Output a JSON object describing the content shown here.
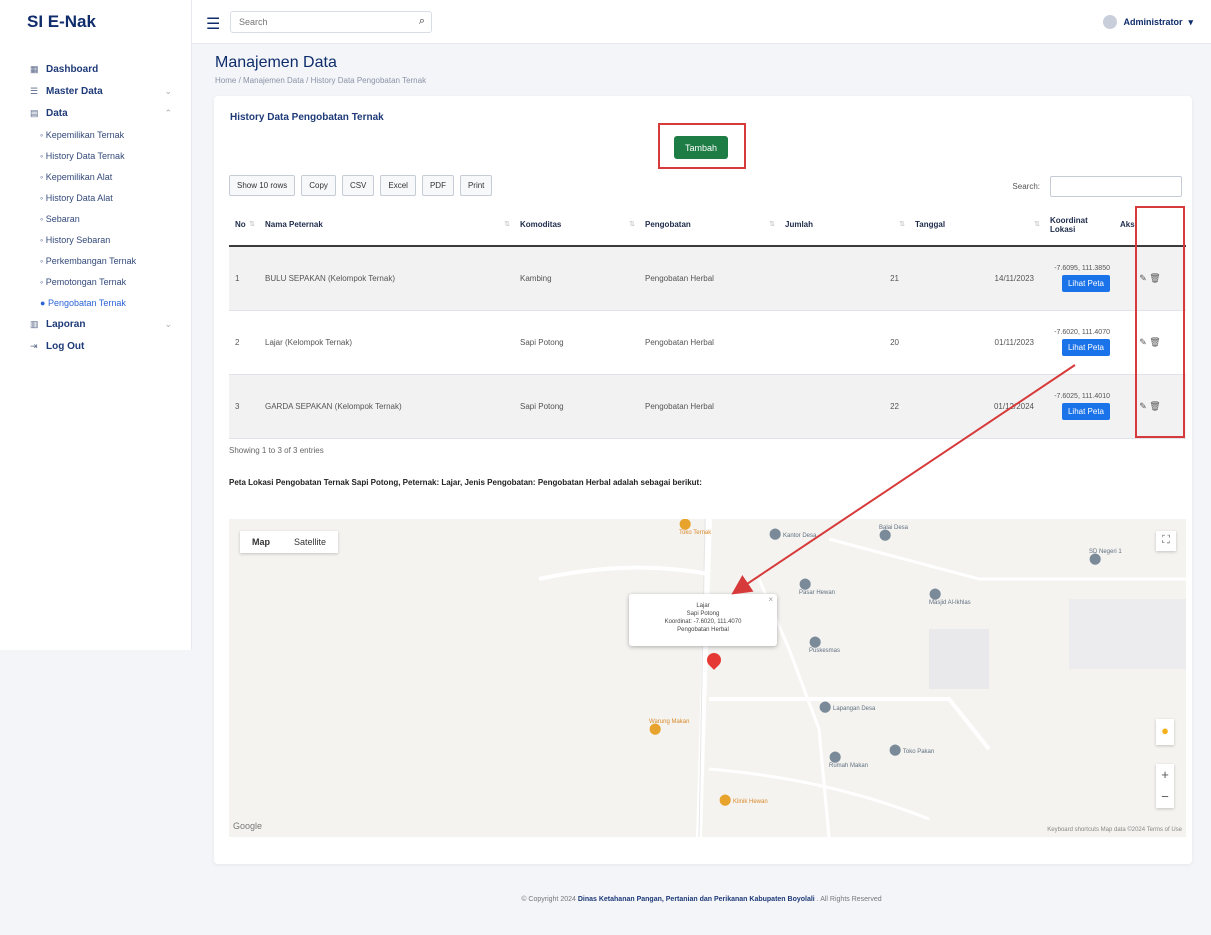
{
  "app": {
    "brand": "SI E-Nak"
  },
  "header": {
    "search_placeholder": "Search",
    "user_name": "Administrator"
  },
  "sidebar": {
    "items": [
      {
        "label": "Dashboard"
      },
      {
        "label": "Master Data"
      },
      {
        "label": "Data"
      },
      {
        "label": "Laporan"
      },
      {
        "label": "Log Out"
      }
    ],
    "sub_items": [
      {
        "label": "Kepemilikan Ternak"
      },
      {
        "label": "History Data Ternak"
      },
      {
        "label": "Kepemilikan Alat"
      },
      {
        "label": "History Data Alat"
      },
      {
        "label": "Sebaran"
      },
      {
        "label": "History Sebaran"
      },
      {
        "label": "Perkembangan Ternak"
      },
      {
        "label": "Pemotongan Ternak"
      },
      {
        "label": "Pengobatan Ternak"
      }
    ]
  },
  "page": {
    "title": "Manajemen Data",
    "breadcrumb": "Home / Manajemen Data / History Data Pengobatan Ternak"
  },
  "card": {
    "title": "History Data Pengobatan Ternak",
    "add_label": "Tambah",
    "export_buttons": [
      "Show 10 rows",
      "Copy",
      "CSV",
      "Excel",
      "PDF",
      "Print"
    ],
    "search_label": "Search:",
    "columns": [
      "No",
      "Nama Peternak",
      "Komoditas",
      "Pengobatan",
      "Jumlah",
      "Tanggal",
      "Koordinat Lokasi",
      "Aksi"
    ],
    "rows": [
      {
        "no": "1",
        "nama": "BULU SEPAKAN (Kelompok Ternak)",
        "komoditas": "Kambing",
        "pengobatan": "Pengobatan Herbal",
        "jumlah": "21",
        "tanggal": "14/11/2023",
        "koordinat": "-7.6095, 111.3850",
        "map_btn": "Lihat Peta",
        "aksi": "✎ 🗑"
      },
      {
        "no": "2",
        "nama": "Lajar (Kelompok Ternak)",
        "komoditas": "Sapi Potong",
        "pengobatan": "Pengobatan Herbal",
        "jumlah": "20",
        "tanggal": "01/11/2023",
        "koordinat": "-7.6020, 111.4070",
        "map_btn": "Lihat Peta",
        "aksi": "✎ 🗑"
      },
      {
        "no": "3",
        "nama": "GARDA SEPAKAN (Kelompok Ternak)",
        "komoditas": "Sapi Potong",
        "pengobatan": "Pengobatan Herbal",
        "jumlah": "22",
        "tanggal": "01/12/2024",
        "koordinat": "-7.6025, 111.4010",
        "map_btn": "Lihat Peta",
        "aksi": "✎ 🗑"
      }
    ],
    "showing": "Showing 1 to 3 of 3 entries",
    "map_caption": "Peta Lokasi Pengobatan Ternak Sapi Potong, Peternak: Lajar, Jenis Pengobatan: Pengobatan Herbal adalah sebagai berikut:"
  },
  "map": {
    "tabs": [
      "Map",
      "Satellite"
    ],
    "info": {
      "line1": "Lajar",
      "line2": "Sapi Potong",
      "line3": "Koordinat: -7.6020, 111.4070",
      "line4": "Pengobatan Herbal"
    },
    "pois": [
      "Toko Ternak",
      "Kantor Desa",
      "Balai Desa",
      "Pasar Hewan",
      "Masjid Al-Ikhlas",
      "SD Negeri 1",
      "Puskesmas",
      "Lapangan Desa",
      "Warung Makan",
      "Toko Pakan",
      "Rumah Makan",
      "Klinik Hewan"
    ],
    "google": "Google",
    "attribution": "Keyboard shortcuts   Map data ©2024   Terms of Use"
  },
  "footer": {
    "prefix": "© Copyright 2024 ",
    "org": "Dinas Ketahanan Pangan, Pertanian dan Perikanan Kabupaten Boyolali",
    "suffix": " . All Rights Reserved"
  },
  "colors": {
    "primary_navy": "#0f2d6b",
    "success": "#1e7c45",
    "map_button": "#1a73e8",
    "annotation_red": "#d63a3a"
  }
}
